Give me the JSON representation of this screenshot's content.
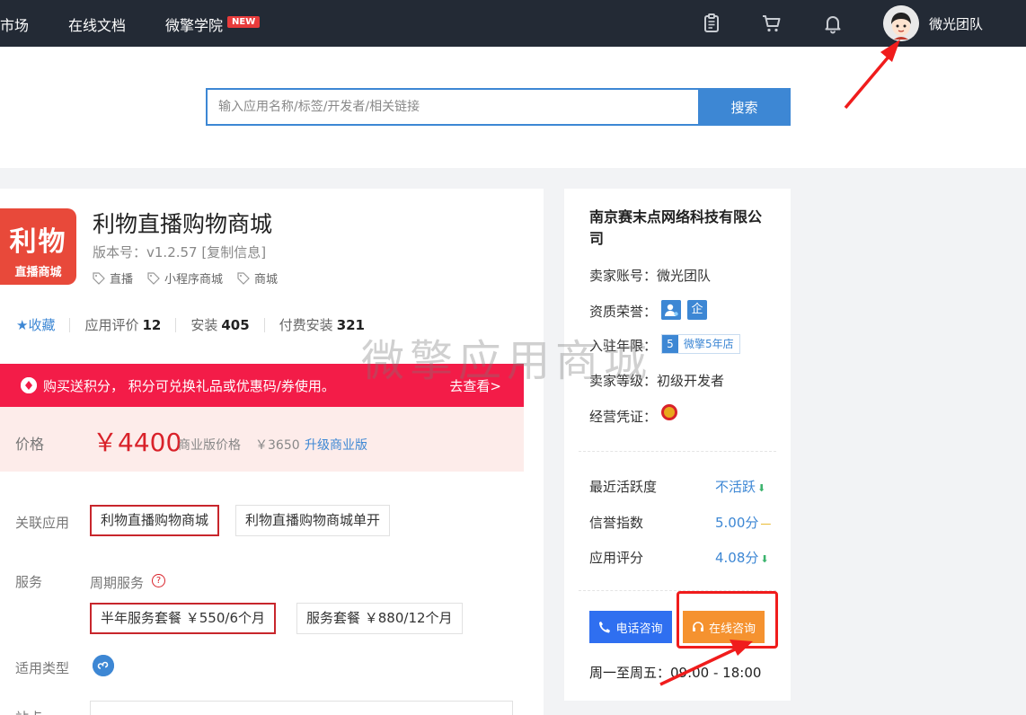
{
  "nav": {
    "items": [
      "市场",
      "在线文档",
      "微擎学院"
    ],
    "new_badge": "NEW",
    "user_name": "微光团队"
  },
  "search": {
    "placeholder": "输入应用名称/标签/开发者/相关链接",
    "button": "搜索"
  },
  "app": {
    "icon_line1": "利物",
    "icon_line2": "直播商城",
    "title": "利物直播购物商城",
    "version": "版本号：v1.2.57 [复制信息]",
    "tags": [
      "直播",
      "小程序商城",
      "商城"
    ],
    "favorite": "★收藏",
    "rating_label": "应用评价",
    "rating_count": "12",
    "install_label": "安装",
    "install_count": "405",
    "paid_label": "付费安装",
    "paid_count": "321"
  },
  "promo": {
    "text": "购买送积分，  积分可兑换礼品或优惠码/券使用。",
    "link": "去查看>"
  },
  "price": {
    "label": "价格",
    "main": "￥4400",
    "business_label": "商业版价格",
    "business_price": "￥3650",
    "upgrade": "升级商业版"
  },
  "related": {
    "label": "关联应用",
    "options": [
      "利物直播购物商城",
      "利物直播购物商城单开"
    ]
  },
  "service": {
    "label": "服务",
    "period_label": "周期服务",
    "options": [
      "半年服务套餐  ￥550/6个月",
      "服务套餐  ￥880/12个月"
    ]
  },
  "type": {
    "label": "适用类型"
  },
  "site": {
    "label": "站点"
  },
  "seller": {
    "company": "南京赛末点网络科技有限公司",
    "account_label": "卖家账号：",
    "account": "微光团队",
    "honor_label": "资质荣誉：",
    "honor_icon_text": "企",
    "years_label": "入驻年限：",
    "years_num": "5",
    "years_text": "微擎5年店",
    "level_label": "卖家等级：",
    "level": "初级开发者",
    "license_label": "经营凭证："
  },
  "metrics": [
    {
      "label": "最近活跃度",
      "value": "不活跃"
    },
    {
      "label": "信誉指数",
      "value": "5.00分"
    },
    {
      "label": "应用评分",
      "value": "4.08分"
    }
  ],
  "contact": {
    "phone": "电话咨询",
    "online": "在线咨询",
    "hours": "周一至周五：09:00 - 18:00"
  },
  "watermark": "微擎应用商城",
  "colors": {
    "topbar": "#232a35",
    "accent_blue": "#3d87d4",
    "promo_red": "#f31c48",
    "price_red": "#d9222a",
    "online_orange": "#f5922f"
  }
}
